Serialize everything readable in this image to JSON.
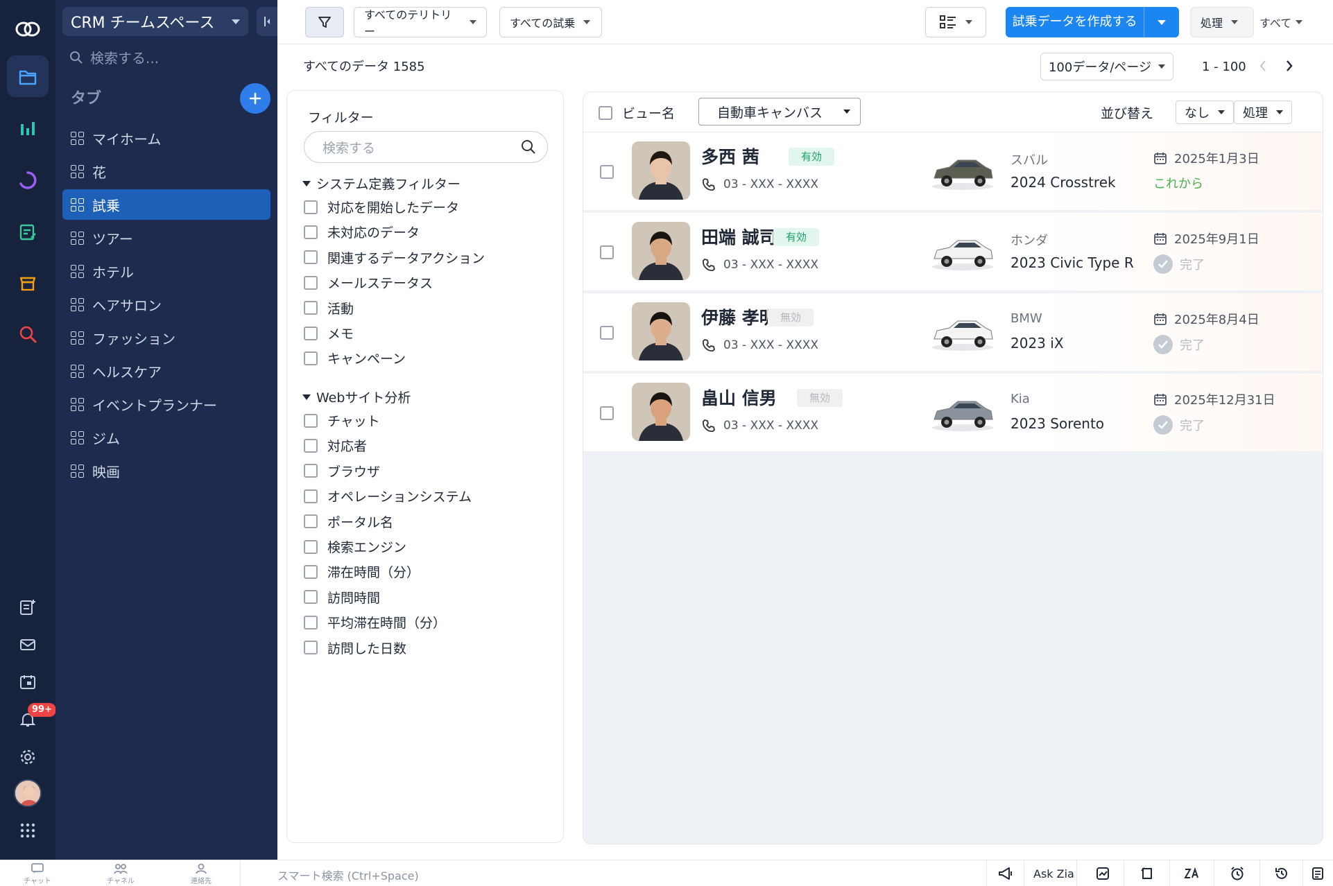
{
  "workspace": {
    "name": "CRM チームスペース"
  },
  "sidebar": {
    "search_placeholder": "検索する...",
    "tabs_heading": "タブ",
    "items": [
      {
        "label": "マイホーム",
        "active": false
      },
      {
        "label": "花",
        "active": false
      },
      {
        "label": "試乗",
        "active": true
      },
      {
        "label": "ツアー",
        "active": false
      },
      {
        "label": "ホテル",
        "active": false
      },
      {
        "label": "ヘアサロン",
        "active": false
      },
      {
        "label": "ファッション",
        "active": false
      },
      {
        "label": "ヘルスケア",
        "active": false
      },
      {
        "label": "イベントプランナー",
        "active": false
      },
      {
        "label": "ジム",
        "active": false
      },
      {
        "label": "映画",
        "active": false
      }
    ]
  },
  "rail": {
    "notification_badge": "99+"
  },
  "toolbar": {
    "territory_filter": "すべてのテリトリー",
    "records_filter": "すべての試乗",
    "create_button": "試乗データを作成する",
    "actions_button": "処理",
    "all_label": "すべて"
  },
  "list_info": {
    "total_label": "すべてのデータ 1585",
    "per_page": "100データ/ページ",
    "range": "1 - 100"
  },
  "filter_panel": {
    "title": "フィルター",
    "search_placeholder": "検索する",
    "sections": [
      {
        "title": "システム定義フィルター",
        "items": [
          "対応を開始したデータ",
          "未対応のデータ",
          "関連するデータアクション",
          "メールステータス",
          "活動",
          "メモ",
          "キャンペーン"
        ]
      },
      {
        "title": "Webサイト分析",
        "items": [
          "チャット",
          "対応者",
          "ブラウザ",
          "オペレーションシステム",
          "ポータル名",
          "検索エンジン",
          "滞在時間（分）",
          "訪問時間",
          "平均滞在時間（分）",
          "訪問した日数"
        ]
      }
    ]
  },
  "canvas_header": {
    "view_label": "ビュー名",
    "view_value": "自動車キャンバス",
    "sort_label": "並び替え",
    "sort_value": "なし",
    "actions_label": "処理"
  },
  "records": [
    {
      "name": "多西 茜",
      "phone": "03 - XXX - XXXX",
      "status": "有効",
      "status_active": true,
      "brand": "スバル",
      "model": "2024 Crosstrek",
      "date": "2025年1月3日",
      "progress": "これから",
      "progress_done": false,
      "car_color": "#5a5f52",
      "skin": "#e9c4a8",
      "hair": "#1f1712"
    },
    {
      "name": "田端 誠司",
      "phone": "03 - XXX - XXXX",
      "status": "有効",
      "status_active": true,
      "brand": "ホンダ",
      "model": "2023 Civic Type R",
      "date": "2025年9月1日",
      "progress": "完了",
      "progress_done": true,
      "car_color": "#f2f2f2",
      "skin": "#d8a884",
      "hair": "#1a1410"
    },
    {
      "name": "伊藤 孝明",
      "phone": "03 - XXX - XXXX",
      "status": "無効",
      "status_active": false,
      "brand": "BMW",
      "model": "2023 iX",
      "date": "2025年8月4日",
      "progress": "完了",
      "progress_done": true,
      "car_color": "#f4f4f4",
      "skin": "#dcae8e",
      "hair": "#15110e"
    },
    {
      "name": "畠山 信男",
      "phone": "03 - XXX - XXXX",
      "status": "無効",
      "status_active": false,
      "brand": "Kia",
      "model": "2023 Sorento",
      "date": "2025年12月31日",
      "progress": "完了",
      "progress_done": true,
      "car_color": "#8a929c",
      "skin": "#d9a27d",
      "hair": "#1a1410"
    }
  ],
  "footer": {
    "tabs": [
      "チャット",
      "チャネル",
      "連絡先"
    ],
    "smart_search": "スマート検索 (Ctrl+Space)",
    "ask_zia": "Ask Zia"
  },
  "colors": {
    "accent": "#1b86f2",
    "sidebar_bg": "#1d2c4e",
    "rail_bg": "#17223c",
    "active_item": "#1e5fb8",
    "status_active": "#17a36b",
    "upcoming": "#4caf50"
  }
}
